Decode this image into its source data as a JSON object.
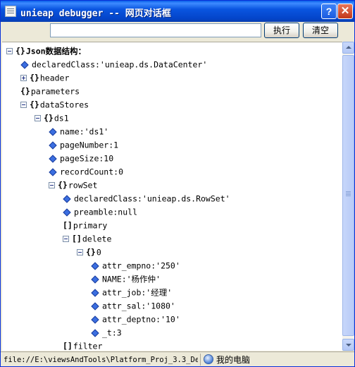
{
  "window": {
    "title": "unieap debugger -- 网页对话框",
    "help_icon": "?",
    "close_icon": "✕"
  },
  "toolbar": {
    "search_value": "",
    "exec_label": "执行",
    "clear_label": "清空"
  },
  "tree": {
    "root": "Json数据结构：",
    "declaredClass_dc": "declaredClass:'unieap.ds.DataCenter'",
    "header": "header",
    "parameters": "parameters",
    "dataStores": "dataStores",
    "ds1": "ds1",
    "name": "name:'ds1'",
    "pageNumber": "pageNumber:1",
    "pageSize": "pageSize:10",
    "recordCount": "recordCount:0",
    "rowSet": "rowSet",
    "declaredClass_rs": "declaredClass:'unieap.ds.RowSet'",
    "preamble": "preamble:null",
    "primary": "primary",
    "delete": "delete",
    "row0": "0",
    "attr_empno": "attr_empno:'250'",
    "NAME": "NAME:'杨作仲'",
    "attr_job": "attr_job:'经理'",
    "attr_sal": "attr_sal:'1080'",
    "attr_deptno": "attr_deptno:'10'",
    "_t": "_t:3",
    "filter": "filter"
  },
  "glyphs": {
    "object": "{}",
    "array": "[]"
  },
  "status": {
    "url": "file://E:\\viewsAndTools\\Platform_Proj_3.3_Dev_",
    "zone": "我的电脑"
  },
  "colors": {
    "titlebar": "#0a55e0",
    "leaf_icon": "#3b6ee0",
    "tree_bg": "#ffffff"
  },
  "icons": {
    "app": "dialog-page-icon",
    "leaf": "blue-diamond-icon",
    "zone": "my-computer-icon"
  }
}
